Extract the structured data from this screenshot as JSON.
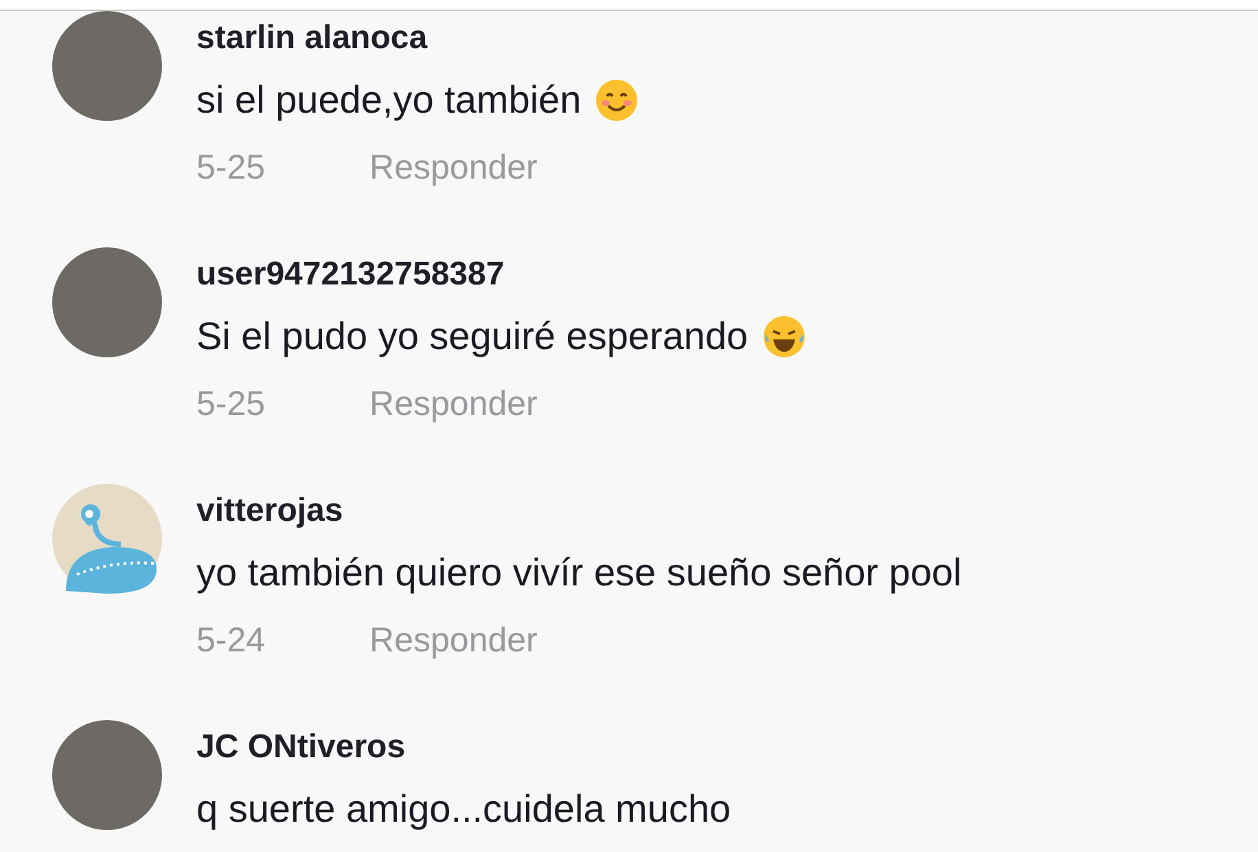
{
  "comments": [
    {
      "avatar": {
        "kind": "photo"
      },
      "username": "starlin alanoca",
      "text": "si el puede,yo también",
      "emoji": {
        "kind": "smile"
      },
      "date": "5-25",
      "reply": "Responder"
    },
    {
      "avatar": {
        "kind": "photo"
      },
      "username": "user9472132758387",
      "text": "Si el pudo yo seguiré esperando",
      "emoji": {
        "kind": "laugh"
      },
      "date": "5-25",
      "reply": "Responder"
    },
    {
      "avatar": {
        "kind": "illustration"
      },
      "username": "vitterojas",
      "text": "yo también quiero vivír ese sueño señor pool",
      "date": "5-24",
      "reply": "Responder"
    },
    {
      "avatar": {
        "kind": "photo"
      },
      "username": "JC ONtiveros",
      "text": "q suerte amigo...cuidela mucho"
    }
  ]
}
